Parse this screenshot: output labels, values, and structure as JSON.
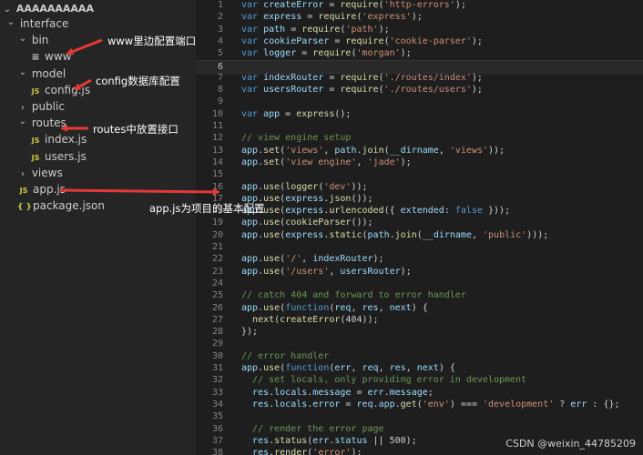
{
  "explorer": {
    "root": "AAAAAAAAAA",
    "items": [
      {
        "label": "interface",
        "kind": "folder",
        "open": true,
        "indent": 0
      },
      {
        "label": "bin",
        "kind": "folder",
        "open": true,
        "indent": 1
      },
      {
        "label": "www",
        "kind": "file",
        "icon": "lines",
        "indent": 2
      },
      {
        "label": "model",
        "kind": "folder",
        "open": true,
        "indent": 1
      },
      {
        "label": "config.js",
        "kind": "file",
        "icon": "JS",
        "indent": 2
      },
      {
        "label": "public",
        "kind": "folder",
        "open": false,
        "indent": 1
      },
      {
        "label": "routes",
        "kind": "folder",
        "open": true,
        "indent": 1
      },
      {
        "label": "index.js",
        "kind": "file",
        "icon": "JS",
        "indent": 2
      },
      {
        "label": "users.js",
        "kind": "file",
        "icon": "JS",
        "indent": 2
      },
      {
        "label": "views",
        "kind": "folder",
        "open": false,
        "indent": 1
      },
      {
        "label": "app.js",
        "kind": "file",
        "icon": "JS",
        "indent": 1
      },
      {
        "label": "package.json",
        "kind": "file",
        "icon": "{}",
        "indent": 1
      }
    ]
  },
  "annotations": [
    {
      "text": "www里边配置端口"
    },
    {
      "text": "config数据库配置"
    },
    {
      "text": "routes中放置接口"
    },
    {
      "text": "app.js为项目的基本配置"
    }
  ],
  "annotation_color": "#e53935",
  "code": [
    {
      "n": "1",
      "t": "var createError = require('http-errors');"
    },
    {
      "n": "2",
      "t": "var express = require('express');"
    },
    {
      "n": "3",
      "t": "var path = require('path');"
    },
    {
      "n": "4",
      "t": "var cookieParser = require('cookie-parser');"
    },
    {
      "n": "5",
      "t": "var logger = require('morgan');"
    },
    {
      "n": "6",
      "t": "",
      "current": true
    },
    {
      "n": "7",
      "t": "var indexRouter = require('./routes/index');"
    },
    {
      "n": "8",
      "t": "var usersRouter = require('./routes/users');"
    },
    {
      "n": "9",
      "t": ""
    },
    {
      "n": "10",
      "t": "var app = express();"
    },
    {
      "n": "11",
      "t": ""
    },
    {
      "n": "12",
      "t": "// view engine setup"
    },
    {
      "n": "13",
      "t": "app.set('views', path.join(__dirname, 'views'));"
    },
    {
      "n": "14",
      "t": "app.set('view engine', 'jade');"
    },
    {
      "n": "15",
      "t": ""
    },
    {
      "n": "16",
      "t": "app.use(logger('dev'));"
    },
    {
      "n": "17",
      "t": "app.use(express.json());"
    },
    {
      "n": "18",
      "t": "app.use(express.urlencoded({ extended: false }));"
    },
    {
      "n": "19",
      "t": "app.use(cookieParser());"
    },
    {
      "n": "20",
      "t": "app.use(express.static(path.join(__dirname, 'public')));"
    },
    {
      "n": "21",
      "t": ""
    },
    {
      "n": "22",
      "t": "app.use('/', indexRouter);"
    },
    {
      "n": "23",
      "t": "app.use('/users', usersRouter);"
    },
    {
      "n": "24",
      "t": ""
    },
    {
      "n": "25",
      "t": "// catch 404 and forward to error handler"
    },
    {
      "n": "26",
      "t": "app.use(function(req, res, next) {"
    },
    {
      "n": "27",
      "t": "  next(createError(404));"
    },
    {
      "n": "28",
      "t": "});"
    },
    {
      "n": "29",
      "t": ""
    },
    {
      "n": "30",
      "t": "// error handler"
    },
    {
      "n": "31",
      "t": "app.use(function(err, req, res, next) {"
    },
    {
      "n": "32",
      "t": "  // set locals, only providing error in development"
    },
    {
      "n": "33",
      "t": "  res.locals.message = err.message;"
    },
    {
      "n": "34",
      "t": "  res.locals.error = req.app.get('env') === 'development' ? err : {};"
    },
    {
      "n": "35",
      "t": ""
    },
    {
      "n": "36",
      "t": "  // render the error page"
    },
    {
      "n": "37",
      "t": "  res.status(err.status || 500);"
    },
    {
      "n": "38",
      "t": "  res.render('error');"
    }
  ],
  "watermark": "CSDN @weixin_44785209"
}
